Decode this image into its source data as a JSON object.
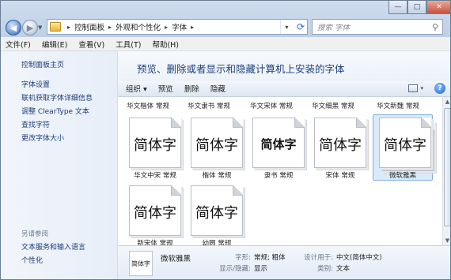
{
  "address": {
    "crumbs": [
      "控制面板",
      "外观和个性化",
      "字体"
    ],
    "search_placeholder": "搜索 字体"
  },
  "window_controls": {
    "minimize": "—",
    "maximize": "□",
    "close": "✕"
  },
  "menu": [
    "文件(F)",
    "编辑(E)",
    "查看(V)",
    "工具(T)",
    "帮助(H)"
  ],
  "sidebar": {
    "home": "控制面板主页",
    "links": [
      "字体设置",
      "联机获取字体详细信息",
      "调整 ClearType 文本",
      "查找字符",
      "更改字体大小"
    ],
    "see_also_label": "另请参阅",
    "see_also": [
      "文本服务和输入语言",
      "个性化"
    ]
  },
  "banner": "预览、删除或者显示和隐藏计算机上安装的字体",
  "toolbar": {
    "organize": "组织 ▾",
    "preview": "预览",
    "delete": "删除",
    "hide": "隐藏"
  },
  "top_captions": [
    "华文楷体 常规",
    "华文隶书 常规",
    "华文宋体 常规",
    "华文细黑 常规",
    "华文新魏 常规"
  ],
  "sample_glyph": "简体字",
  "fonts_row1": [
    {
      "caption": "华文中宋 常规",
      "style": "serif",
      "stacked": false
    },
    {
      "caption": "楷体 常规",
      "style": "serif",
      "stacked": false
    },
    {
      "caption": "隶书 常规",
      "style": "bold",
      "stacked": false
    },
    {
      "caption": "宋体 常规",
      "style": "serif",
      "stacked": false
    },
    {
      "caption": "微软雅黑",
      "style": "sans",
      "stacked": true,
      "selected": true
    }
  ],
  "fonts_row2": [
    {
      "caption": "新宋体 常规",
      "style": "serif"
    },
    {
      "caption": "幼圆 常规",
      "style": "sans"
    }
  ],
  "details": {
    "thumb_text": "简体字",
    "name": "微软雅黑",
    "style_label": "字形:",
    "style_value": "常规; 粗体",
    "visibility_label": "显示/隐藏:",
    "visibility_value": "显示",
    "designed_label": "设计用于:",
    "designed_value": "中文(简体中文)",
    "category_label": "类别:",
    "category_value": "文本"
  }
}
